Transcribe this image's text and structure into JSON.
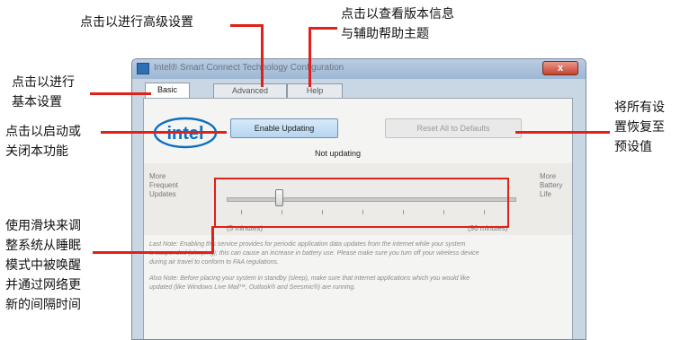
{
  "annotations": {
    "advanced": "点击以进行高级设置",
    "help_line1": "点击以查看版本信息",
    "help_line2": "与辅助帮助主题",
    "basic_line1": "点击以进行",
    "basic_line2": "基本设置",
    "enable_line1": "点击以启动或",
    "enable_line2": "关闭本功能",
    "reset_line1": "将所有设",
    "reset_line2": "置恢复至",
    "reset_line3": "预设值",
    "slider_line1": "使用滑块来调",
    "slider_line2": "整系统从睡眠",
    "slider_line3": "模式中被唤醒",
    "slider_line4": "并通过网络更",
    "slider_line5": "新的间隔时间"
  },
  "window": {
    "title": "Intel® Smart Connect Technology Configuration",
    "close_symbol": "x"
  },
  "tabs": [
    {
      "label": "Basic",
      "active": true
    },
    {
      "label": "Advanced",
      "active": false
    },
    {
      "label": "Help",
      "active": false
    }
  ],
  "logo": {
    "text": "intel"
  },
  "buttons": {
    "enable": "Enable Updating",
    "reset": "Reset All to Defaults"
  },
  "status": "Not updating",
  "slider": {
    "left_label_1": "More",
    "left_label_2": "Frequent",
    "left_label_3": "Updates",
    "right_label_1": "More",
    "right_label_2": "Battery",
    "right_label_3": "Life",
    "min_label": "(5 minutes)",
    "max_label": "(90 minutes)",
    "position_fraction": 0.18
  },
  "notes": {
    "note1_line1": "Last Note: Enabling this service provides for periodic application data updates from the internet while your system",
    "note1_line2": "is suspended (sleeping); this can cause an increase in battery use. Please make sure you turn off your wireless device",
    "note1_line3": "during air travel to conform to FAA regulations.",
    "note2_line1": "Also Note: Before placing your system in standby (sleep), make sure that internet applications which you would like",
    "note2_line2": "updated (like Windows Live Mail™, Outlook® and Seesmic®) are running."
  },
  "colors": {
    "annotation_red": "#e0201a",
    "intel_blue": "#0b6fc2"
  }
}
